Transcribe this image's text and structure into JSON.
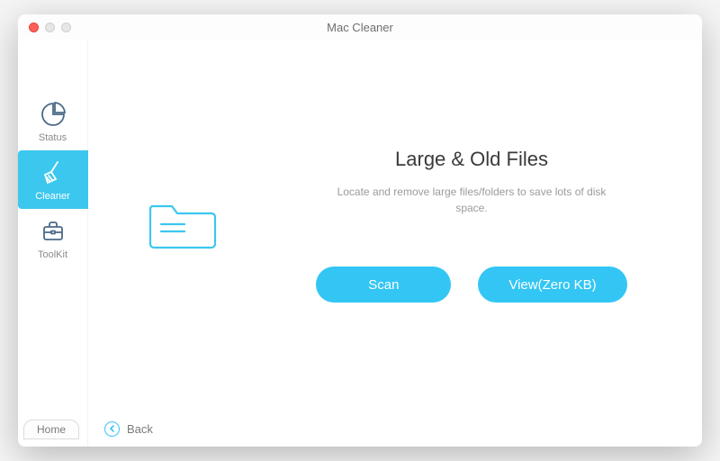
{
  "window": {
    "title": "Mac Cleaner"
  },
  "sidebar": {
    "items": [
      {
        "label": "Status"
      },
      {
        "label": "Cleaner"
      },
      {
        "label": "ToolKit"
      }
    ]
  },
  "content": {
    "heading": "Large & Old Files",
    "description": "Locate and remove large files/folders to save lots of disk space.",
    "scan_label": "Scan",
    "view_label": "View(Zero KB)"
  },
  "footer": {
    "back_label": "Back",
    "home_label": "Home"
  },
  "icons": {
    "folder": "folder-icon",
    "status": "pie-chart-icon",
    "cleaner": "broom-icon",
    "toolkit": "briefcase-icon",
    "back": "back-icon"
  }
}
